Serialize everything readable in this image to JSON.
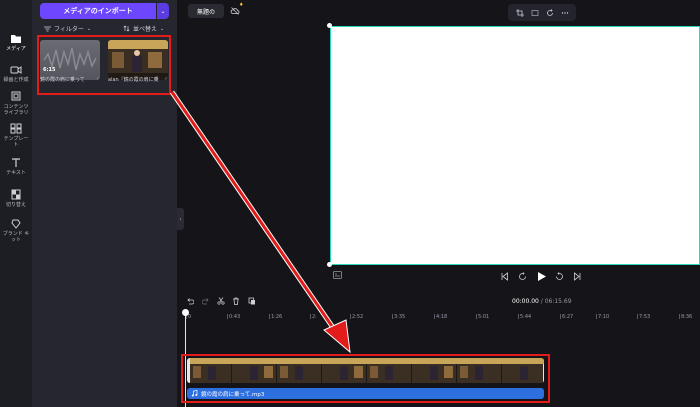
{
  "sidebar": {
    "items": [
      {
        "label": "メディア",
        "icon": "folder-icon",
        "active": true
      },
      {
        "label": "録画と作成",
        "icon": "video-camera-icon"
      },
      {
        "label": "コンテンツ\nライブラリ",
        "icon": "library-icon"
      },
      {
        "label": "テンプレー\nト",
        "icon": "template-icon"
      },
      {
        "label": "テキスト",
        "icon": "text-icon"
      },
      {
        "label": "切り替え",
        "icon": "transition-icon"
      },
      {
        "label": "ブランド キ\nット",
        "icon": "brand-kit-icon"
      }
    ]
  },
  "media": {
    "import_label": "メディアのインポート",
    "filter_label": "フィルター",
    "sort_label": "並べ替え",
    "items": [
      {
        "duration": "6:15",
        "caption": "鏡の霞の肩に乗って"
      },
      {
        "duration": "",
        "caption": "alan『鏡の霞の肩に乗"
      }
    ]
  },
  "header": {
    "project_title": "無題の",
    "toolbar_icons": [
      "crop-icon",
      "fit-icon",
      "rotate-icon",
      "more-icon"
    ]
  },
  "timeline": {
    "current_time": "00:00.00",
    "total_time": "06:15.69",
    "ticks": [
      "0",
      "0:43",
      "1:26",
      "2:",
      "2:52",
      "3:35",
      "4:18",
      "5:01",
      "5:44",
      "6:27",
      "7:10",
      "7:53",
      "8:36"
    ],
    "audio_clip_label": "鏡の霞の肩に乗って.mp3"
  },
  "colors": {
    "accent": "#6c47ff",
    "annotation_red": "#e21b1b",
    "canvas_border": "#2ad9b9",
    "audio_track": "#2e6fe0",
    "video_track": "#2a9e93"
  }
}
